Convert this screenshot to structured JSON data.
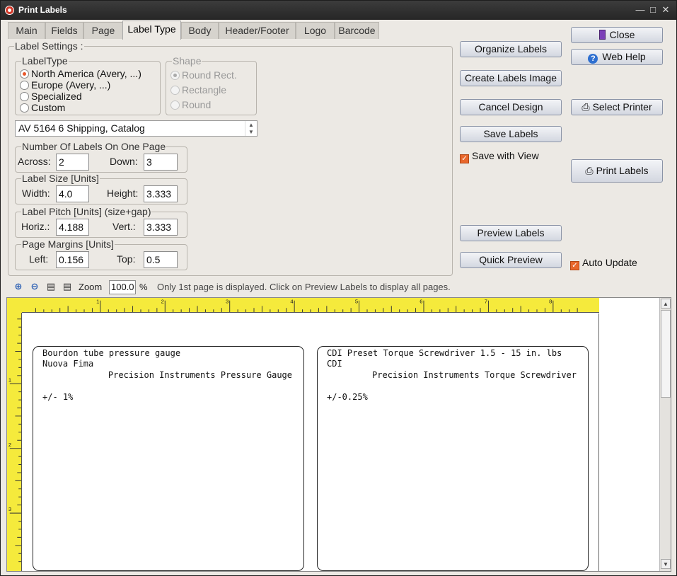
{
  "window": {
    "title": "Print Labels"
  },
  "tabs": [
    "Main",
    "Fields",
    "Page",
    "Label Type",
    "Body",
    "Header/Footer",
    "Logo",
    "Barcode"
  ],
  "active_tab": "Label Type",
  "label_settings": {
    "title": "Label Settings :",
    "label_type": {
      "legend": "LabelType",
      "options": [
        "North America (Avery, ...)",
        "Europe (Avery, ...)",
        "Specialized",
        "Custom"
      ],
      "selected": "North America (Avery, ...)"
    },
    "shape": {
      "legend": "Shape",
      "options": [
        "Round Rect.",
        "Rectangle",
        "Round"
      ],
      "selected": "Round Rect."
    },
    "label_combo": "AV 5164   6  Shipping, Catalog",
    "number_of_labels": {
      "legend": "Number Of Labels On One Page",
      "across_label": "Across:",
      "across": "2",
      "down_label": "Down:",
      "down": "3"
    },
    "label_size": {
      "legend": "Label Size [Units]",
      "width_label": "Width:",
      "width": "4.0",
      "height_label": "Height:",
      "height": "3.333"
    },
    "label_pitch": {
      "legend": "Label Pitch [Units] (size+gap)",
      "horiz_label": "Horiz.:",
      "horiz": "4.188",
      "vert_label": "Vert.:",
      "vert": "3.333"
    },
    "page_margins": {
      "legend": "Page Margins [Units]",
      "left_label": "Left:",
      "left": "0.156",
      "top_label": "Top:",
      "top": "0.5"
    }
  },
  "buttons": {
    "organize": "Organize Labels",
    "create_image": "Create Labels Image",
    "cancel_design": "Cancel Design",
    "save_labels": "Save Labels",
    "save_with_view": "Save with View",
    "preview_labels": "Preview Labels",
    "quick_preview": "Quick Preview",
    "auto_update": "Auto Update",
    "close": "Close",
    "web_help": "Web Help",
    "select_printer": "Select Printer",
    "print_labels": "Print Labels"
  },
  "toolbar": {
    "zoom_label": "Zoom",
    "zoom_value": "100.0",
    "zoom_unit": "%",
    "info": "Only 1st page is displayed. Click on Preview Labels to display all pages."
  },
  "rulers": {
    "horizontal": [
      "1",
      "2",
      "3",
      "4",
      "5",
      "6",
      "7",
      "8"
    ],
    "vertical": [
      "1",
      "2",
      "3"
    ]
  },
  "labels": [
    {
      "line1": "Bourdon tube pressure gauge",
      "line2": "Nuova Fima",
      "line3": "Precision Instruments Pressure Gauge",
      "line4": "+/- 1%"
    },
    {
      "line1": "CDI Preset Torque Screwdriver 1.5 - 15 in. lbs",
      "line2": "CDI",
      "line3": "Precision Instruments Torque Screwdriver",
      "line4": "+/-0.25%"
    }
  ],
  "colors": {
    "accent": "#e8672c",
    "ruler": "#f5ea3c",
    "titlebar": "#2f2f2f"
  }
}
